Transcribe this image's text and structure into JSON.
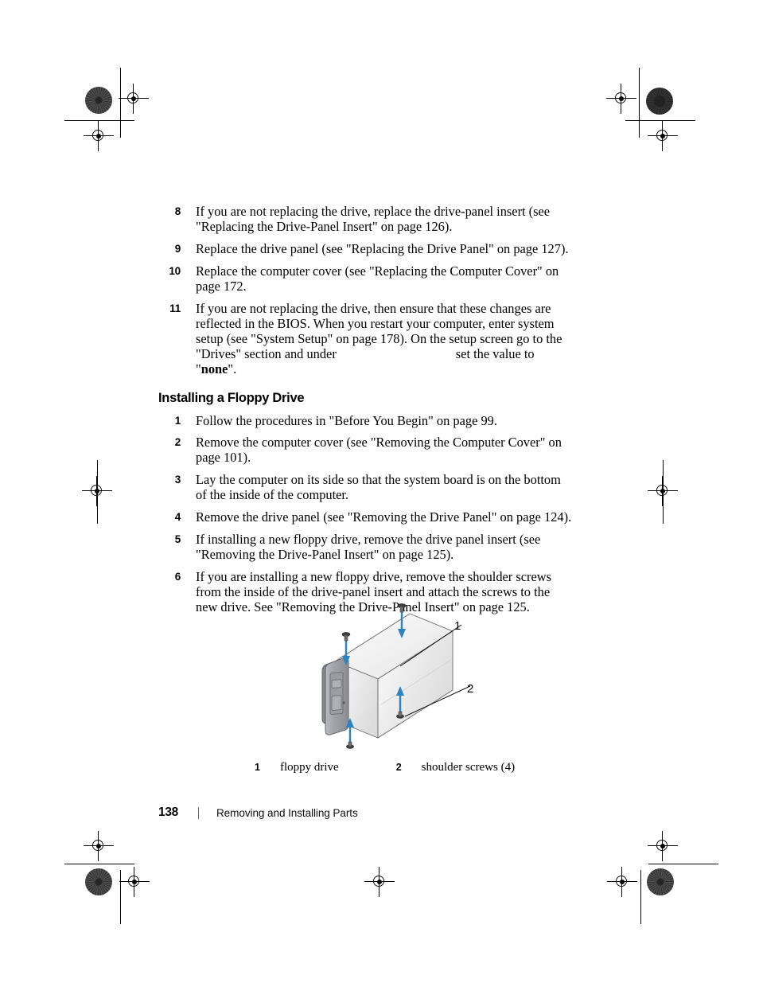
{
  "document": {
    "page_number": "138",
    "footer_title": "Removing and Installing Parts"
  },
  "continued_steps": [
    {
      "num": "8",
      "text_before": "If you are not replacing the drive, replace the drive-panel insert (see \"Replacing the Drive-Panel Insert\" on page 126).",
      "text_after": ""
    },
    {
      "num": "9",
      "text_before": "Replace the drive panel (see \"Replacing the Drive Panel\" on page 127).",
      "text_after": ""
    },
    {
      "num": "10",
      "text_before": "Replace the computer cover (see \"Replacing the Computer Cover\" on page 172.",
      "text_after": ""
    },
    {
      "num": "11",
      "text_before": "If you are not replacing the drive, then ensure that these changes are reflected in the BIOS. When you restart your computer, enter system setup (see \"System Setup\" on page 178). On the setup screen go to the \"Drives\" section and under",
      "text_after": "set the value to \"",
      "bold_value": "none",
      "text_tail": "\"."
    }
  ],
  "section": {
    "heading": "Installing a Floppy Drive",
    "steps": [
      {
        "num": "1",
        "text": "Follow the procedures in \"Before You Begin\" on page 99."
      },
      {
        "num": "2",
        "text": "Remove the computer cover (see \"Removing the Computer Cover\" on page 101)."
      },
      {
        "num": "3",
        "text": "Lay the computer on its side so that the system board is on the bottom of the inside of the computer."
      },
      {
        "num": "4",
        "text": "Remove the drive panel (see \"Removing the Drive Panel\" on page 124)."
      },
      {
        "num": "5",
        "text": "If installing a new floppy drive, remove the drive panel insert (see \"Removing the Drive-Panel Insert\" on page 125)."
      },
      {
        "num": "6",
        "text": "If you are installing a new floppy drive, remove the shoulder screws from the inside of the drive-panel insert and attach the screws to the new drive. See \"Removing the Drive-Panel Insert\" on page 125."
      }
    ]
  },
  "figure": {
    "callouts": [
      {
        "num": "1",
        "label": ""
      },
      {
        "num": "2",
        "label": ""
      }
    ],
    "caption_items": [
      {
        "num": "1",
        "label": "floppy drive"
      },
      {
        "num": "2",
        "label": "shoulder screws (4)"
      }
    ],
    "colors": {
      "arrow_blue": "#2b83c4",
      "drive_body_light": "#f2f2f2",
      "bezel_gray": "#9a9ca1",
      "outline": "#4a4a4a"
    }
  }
}
